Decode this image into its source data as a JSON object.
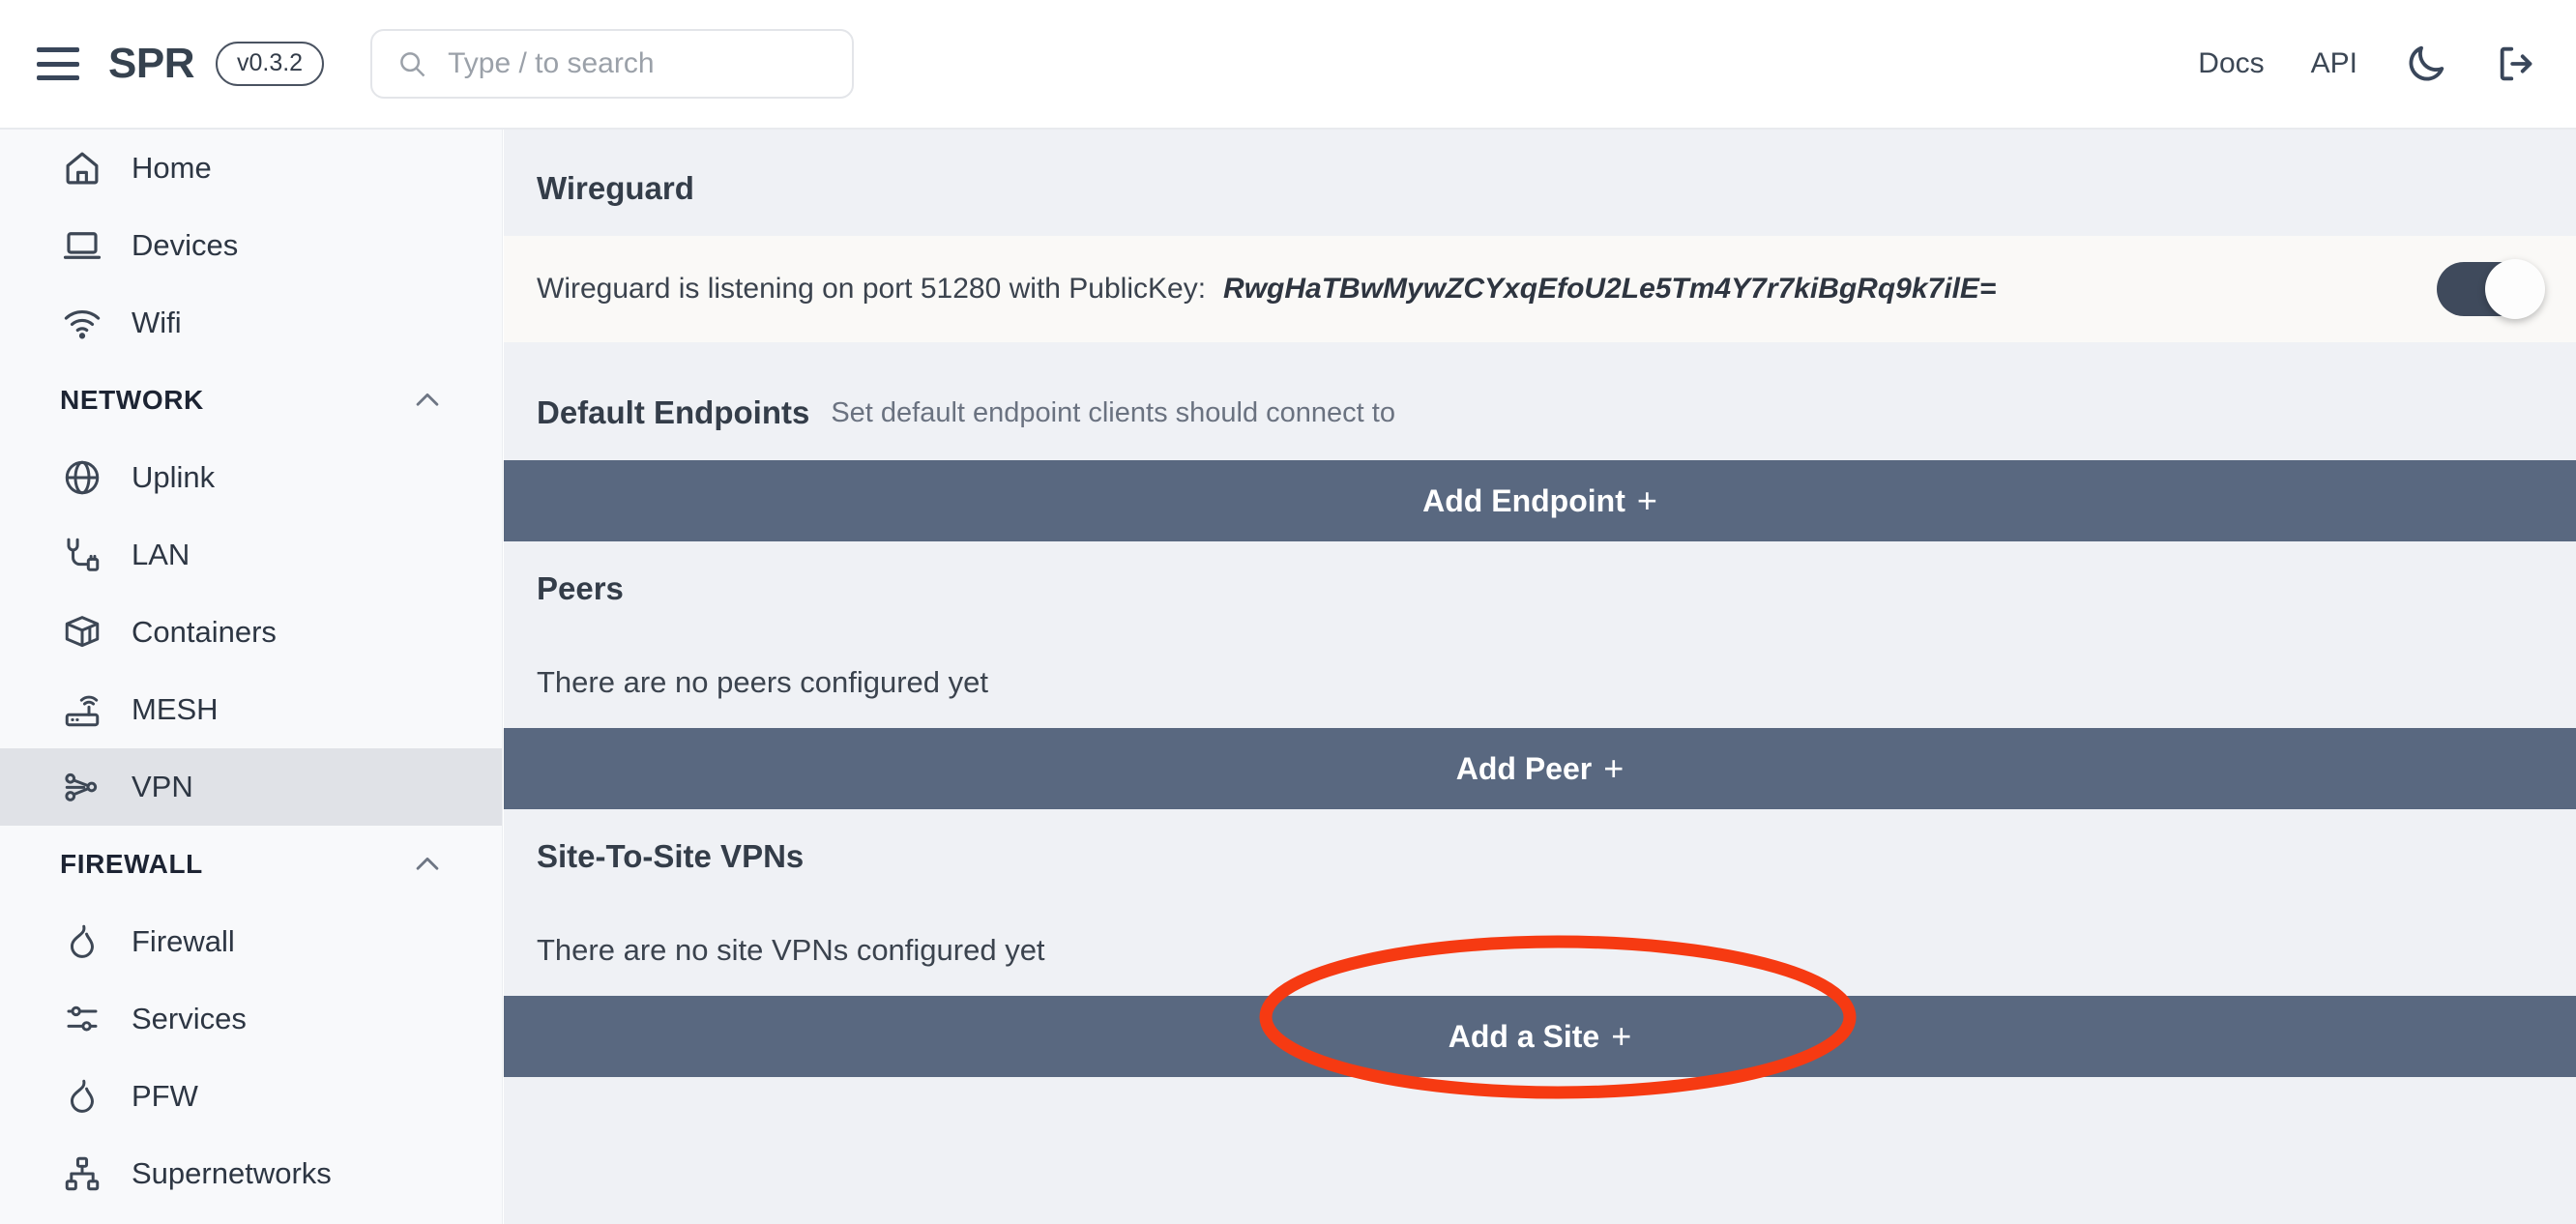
{
  "header": {
    "menu_icon": "hamburger-icon",
    "brand": "SPR",
    "version": "v0.3.2",
    "search_placeholder": "Type / to search",
    "search_icon": "search-icon",
    "docs_label": "Docs",
    "api_label": "API",
    "theme_icon": "moon-icon",
    "logout_icon": "logout-icon"
  },
  "sidebar": {
    "items": [
      {
        "type": "item",
        "label": "Home",
        "icon": "home-icon",
        "active": false
      },
      {
        "type": "item",
        "label": "Devices",
        "icon": "laptop-icon",
        "active": false
      },
      {
        "type": "item",
        "label": "Wifi",
        "icon": "wifi-icon",
        "active": false
      },
      {
        "type": "section",
        "label": "NETWORK",
        "icon": "chevron-up-icon"
      },
      {
        "type": "item",
        "label": "Uplink",
        "icon": "globe-icon",
        "active": false
      },
      {
        "type": "item",
        "label": "LAN",
        "icon": "ethernet-plug-icon",
        "active": false
      },
      {
        "type": "item",
        "label": "Containers",
        "icon": "container-box-icon",
        "active": false
      },
      {
        "type": "item",
        "label": "MESH",
        "icon": "router-icon",
        "active": false
      },
      {
        "type": "item",
        "label": "VPN",
        "icon": "network-nodes-icon",
        "active": true
      },
      {
        "type": "section",
        "label": "FIREWALL",
        "icon": "chevron-up-icon"
      },
      {
        "type": "item",
        "label": "Firewall",
        "icon": "flame-icon",
        "active": false
      },
      {
        "type": "item",
        "label": "Services",
        "icon": "sliders-icon",
        "active": false
      },
      {
        "type": "item",
        "label": "PFW",
        "icon": "flame-icon",
        "active": false
      },
      {
        "type": "item",
        "label": "Supernetworks",
        "icon": "sitemap-icon",
        "active": false
      }
    ]
  },
  "main": {
    "wireguard": {
      "title": "Wireguard",
      "status_text": "Wireguard is listening on port 51280 with PublicKey:",
      "public_key": "RwgHaTBwMywZCYxqEfoU2Le5Tm4Y7r7kiBgRq9k7ilE=",
      "toggle_on": true
    },
    "endpoints": {
      "title": "Default Endpoints",
      "subtitle": "Set default endpoint clients should connect to",
      "add_label": "Add Endpoint",
      "add_plus": "+"
    },
    "peers": {
      "title": "Peers",
      "empty_text": "There are no peers configured yet",
      "add_label": "Add Peer",
      "add_plus": "+"
    },
    "sites": {
      "title": "Site-To-Site VPNs",
      "empty_text": "There are no site VPNs configured yet",
      "add_label": "Add a Site",
      "add_plus": "+"
    }
  },
  "annotation": {
    "shape": "ellipse-highlight",
    "color": "#F63A12",
    "target": "Add a Site"
  },
  "colors": {
    "action_bar": "#596880",
    "content_bg": "#eff1f5",
    "sidebar_bg": "#f8f9fb",
    "sidebar_active": "#e0e2e7",
    "highlight": "#F63A12"
  }
}
